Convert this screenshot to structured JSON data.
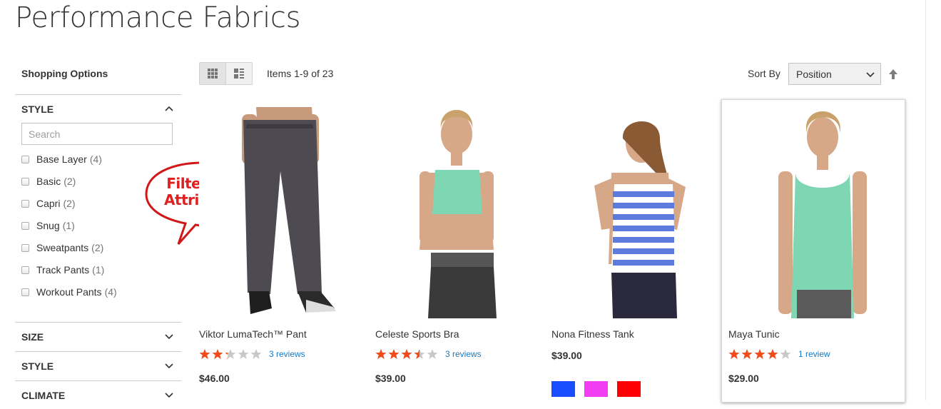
{
  "page": {
    "title": "Performance Fabrics"
  },
  "sidebar": {
    "heading": "Shopping Options",
    "style_filter": {
      "title": "STYLE",
      "search_placeholder": "Search",
      "options": [
        {
          "name": "Base Layer",
          "count": "(4)"
        },
        {
          "name": "Basic",
          "count": "(2)"
        },
        {
          "name": "Capri",
          "count": "(2)"
        },
        {
          "name": "Snug",
          "count": "(1)"
        },
        {
          "name": "Sweatpants",
          "count": "(2)"
        },
        {
          "name": "Track Pants",
          "count": "(1)"
        },
        {
          "name": "Workout Pants",
          "count": "(4)"
        }
      ]
    },
    "collapsed_filters": [
      "SIZE",
      "STYLE",
      "CLIMATE"
    ]
  },
  "callout": {
    "line1": "Filterable",
    "line2": "Attributes"
  },
  "toolbar": {
    "amount": "Items 1-9 of 23",
    "sort_label": "Sort By",
    "sort_value": "Position",
    "view_modes": [
      "grid",
      "list"
    ],
    "active_mode": "grid"
  },
  "products": [
    {
      "name": "Viktor LumaTech™ Pant",
      "rating_fraction": 0.5,
      "reviews": "3 reviews",
      "price": "$46.00"
    },
    {
      "name": "Celeste Sports Bra",
      "rating_fraction": 0.7,
      "reviews": "3 reviews",
      "price": "$39.00"
    },
    {
      "name": "Nona Fitness Tank",
      "price": "$39.00",
      "swatches": [
        "#1a4cff",
        "#f23ef2",
        "#ff0000"
      ]
    },
    {
      "name": "Maya Tunic",
      "rating_fraction": 0.8,
      "reviews": "1 review",
      "price": "$29.00"
    }
  ],
  "colors": {
    "star_on": "#f04b1a",
    "star_off": "#c8c8c8",
    "link": "#1979c3",
    "callout_red": "#e02020"
  }
}
